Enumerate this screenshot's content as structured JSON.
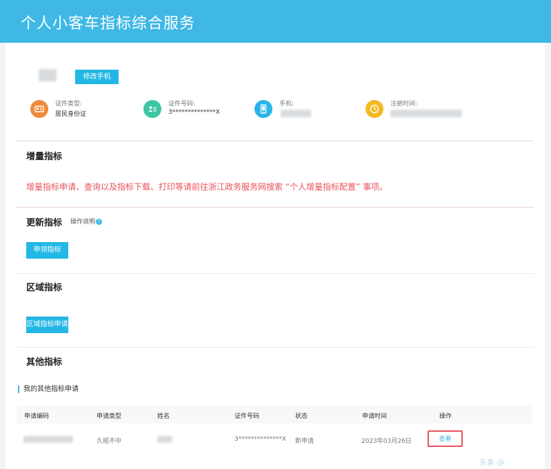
{
  "header": {
    "title": "个人小客车指标综合服务"
  },
  "profile": {
    "change_phone_label": "修改手机",
    "info": [
      {
        "label": "证件类型:",
        "value": "居民身份证",
        "icon": "id-card-icon",
        "color": "#f08a3c"
      },
      {
        "label": "证件号码:",
        "value": "3**************X",
        "icon": "contact-card-icon",
        "color": "#3cc7a0"
      },
      {
        "label": "手机:",
        "value": "",
        "icon": "phone-icon",
        "color": "#2ab4e8"
      },
      {
        "label": "注册时间:",
        "value": "",
        "icon": "clock-icon",
        "color": "#f5b924"
      }
    ]
  },
  "incremental": {
    "title": "增量指标",
    "notice": "增量指标申请、查询以及指标下载、打印等请前往浙江政务服务网搜索 “个人增量指标配置” 事项。"
  },
  "renewal": {
    "title": "更新指标",
    "help": "操作说明",
    "button": "申领指标"
  },
  "region": {
    "title": "区域指标",
    "button": "区域指标申请"
  },
  "other": {
    "title": "其他指标",
    "subheading": "我的其他指标申请",
    "columns": [
      "申请编码",
      "申请类型",
      "姓名",
      "证件号码",
      "状态",
      "申请时间",
      "操作"
    ],
    "row": {
      "type": "久摇不中",
      "id_number": "3**************X",
      "status": "新申请",
      "time": "2023年03月26日",
      "action": "查看"
    }
  },
  "watermark": "头条 @"
}
